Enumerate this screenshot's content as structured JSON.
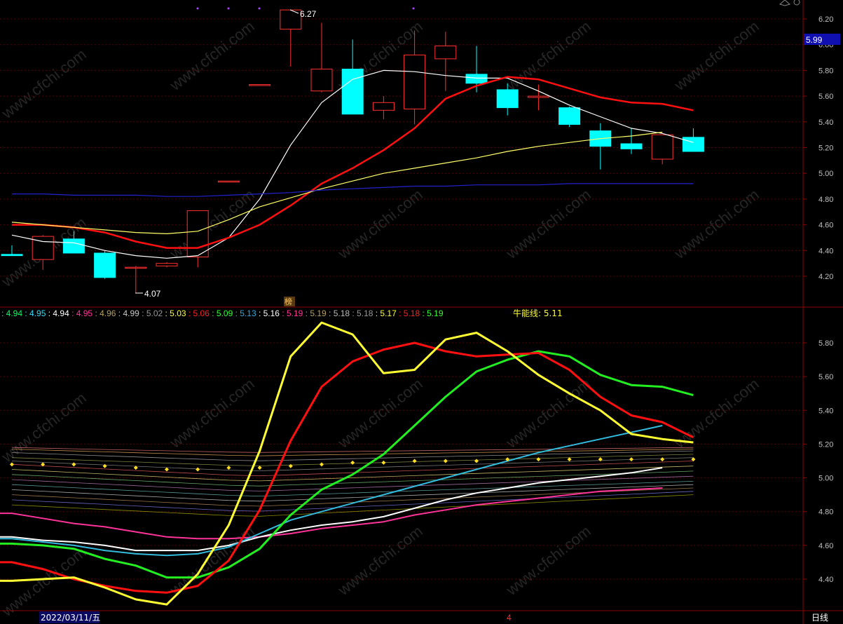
{
  "watermark": "www.cfchi.com",
  "colors": {
    "bg": "#000000",
    "grid": "#5a0000",
    "border": "#8b0000",
    "axis_text": "#c0c0c0",
    "bull": "#ff3030",
    "bear": "#00ffff",
    "ma5": "#ffffff",
    "ma10": "#ffff66",
    "ma20": "#ff1010",
    "ma60": "#2222cc"
  },
  "price_axis": {
    "ticks": [
      "6.20",
      "6.00",
      "5.80",
      "5.60",
      "5.40",
      "5.20",
      "5.00",
      "4.80",
      "4.60",
      "4.40",
      "4.20"
    ],
    "current_price": "5.99",
    "max_label": "6.27",
    "min_label": "4.07",
    "marker_label": "榜"
  },
  "indicator_axis": {
    "ticks": [
      "5.80",
      "5.60",
      "5.40",
      "5.20",
      "5.00",
      "4.80",
      "4.60",
      "4.40"
    ]
  },
  "legend": {
    "values": [
      {
        "text": ": 4.94",
        "color": "#00ff66"
      },
      {
        "text": ": 4.95",
        "color": "#33ddff"
      },
      {
        "text": ": 4.94",
        "color": "#ffffff"
      },
      {
        "text": ": 4.95",
        "color": "#ff3399"
      },
      {
        "text": ": 4.96",
        "color": "#b8a060"
      },
      {
        "text": ": 4.99",
        "color": "#c8c8c8"
      },
      {
        "text": ": 5.02",
        "color": "#999999"
      },
      {
        "text": ": 5.03",
        "color": "#ffff33"
      },
      {
        "text": ": 5.06",
        "color": "#ff2222"
      },
      {
        "text": ": 5.09",
        "color": "#33ff33"
      },
      {
        "text": ": 5.13",
        "color": "#33aadd"
      },
      {
        "text": ": 5.16",
        "color": "#ffffff"
      },
      {
        "text": ": 5.19",
        "color": "#ff3399"
      },
      {
        "text": ": 5.19",
        "color": "#b8a060"
      },
      {
        "text": ": 5.18",
        "color": "#bbbbbb"
      },
      {
        "text": ": 5.18",
        "color": "#999999"
      },
      {
        "text": ": 5.17",
        "color": "#ffff33"
      },
      {
        "text": ": 5.18",
        "color": "#ff2222"
      },
      {
        "text": ": 5.19",
        "color": "#33ff33"
      }
    ],
    "bull_line_label": "牛能线: 5.11"
  },
  "bottom_bar": {
    "date": "2022/03/11/五",
    "month_marker": "4",
    "period": "日线"
  },
  "chart_data": [
    {
      "type": "candlestick",
      "ylim": [
        4.1,
        6.3
      ],
      "candles": [
        {
          "o": 4.37,
          "h": 4.44,
          "l": 4.36,
          "c": 4.36
        },
        {
          "o": 4.33,
          "h": 4.52,
          "l": 4.25,
          "c": 4.51
        },
        {
          "o": 4.49,
          "h": 4.55,
          "l": 4.39,
          "c": 4.38
        },
        {
          "o": 4.38,
          "h": 4.4,
          "l": 4.18,
          "c": 4.19
        },
        {
          "o": 4.27,
          "h": 4.28,
          "l": 4.07,
          "c": 4.27
        },
        {
          "o": 4.28,
          "h": 4.31,
          "l": 4.27,
          "c": 4.3
        },
        {
          "o": 4.35,
          "h": 4.71,
          "l": 4.27,
          "c": 4.71
        },
        {
          "o": 4.94,
          "h": 4.94,
          "l": 4.94,
          "c": 4.94
        },
        {
          "o": 5.69,
          "h": 5.69,
          "l": 5.69,
          "c": 5.69
        },
        {
          "o": 6.12,
          "h": 6.27,
          "l": 5.83,
          "c": 6.27
        },
        {
          "o": 5.64,
          "h": 6.17,
          "l": 5.63,
          "c": 5.81
        },
        {
          "o": 5.81,
          "h": 6.04,
          "l": 5.46,
          "c": 5.46
        },
        {
          "o": 5.49,
          "h": 5.6,
          "l": 5.42,
          "c": 5.55
        },
        {
          "o": 5.5,
          "h": 6.11,
          "l": 5.38,
          "c": 5.92
        },
        {
          "o": 5.89,
          "h": 6.1,
          "l": 5.64,
          "c": 5.99
        },
        {
          "o": 5.77,
          "h": 5.99,
          "l": 5.63,
          "c": 5.7
        },
        {
          "o": 5.65,
          "h": 5.7,
          "l": 5.45,
          "c": 5.51
        },
        {
          "o": 5.59,
          "h": 5.69,
          "l": 5.49,
          "c": 5.6
        },
        {
          "o": 5.51,
          "h": 5.52,
          "l": 5.36,
          "c": 5.38
        },
        {
          "o": 5.33,
          "h": 5.39,
          "l": 5.03,
          "c": 5.21
        },
        {
          "o": 5.23,
          "h": 5.35,
          "l": 5.15,
          "c": 5.19
        },
        {
          "o": 5.11,
          "h": 5.3,
          "l": 5.07,
          "c": 5.3
        },
        {
          "o": 5.28,
          "h": 5.35,
          "l": 5.17,
          "c": 5.17
        }
      ],
      "ma_lines": [
        {
          "key": "ma5",
          "values": [
            4.52,
            4.47,
            4.46,
            4.4,
            4.36,
            4.34,
            4.36,
            4.5,
            4.8,
            5.22,
            5.55,
            5.73,
            5.8,
            5.79,
            5.76,
            5.74,
            5.74,
            5.64,
            5.53,
            5.44,
            5.35,
            5.31,
            5.24
          ]
        },
        {
          "key": "ma20",
          "values": [
            4.6,
            4.6,
            4.58,
            4.54,
            4.47,
            4.42,
            4.42,
            4.5,
            4.6,
            4.75,
            4.92,
            5.04,
            5.18,
            5.35,
            5.58,
            5.68,
            5.75,
            5.73,
            5.66,
            5.59,
            5.55,
            5.54,
            5.49
          ]
        },
        {
          "key": "ma10",
          "values": [
            4.62,
            4.6,
            4.58,
            4.56,
            4.54,
            4.53,
            4.55,
            4.64,
            4.74,
            4.81,
            4.88,
            4.94,
            5.0,
            5.04,
            5.08,
            5.12,
            5.17,
            5.21,
            5.24,
            5.27,
            5.29,
            5.32
          ]
        },
        {
          "key": "ma60",
          "values": [
            4.84,
            4.84,
            4.83,
            4.83,
            4.83,
            4.82,
            4.82,
            4.83,
            4.84,
            4.85,
            4.87,
            4.88,
            4.89,
            4.9,
            4.9,
            4.91,
            4.91,
            4.91,
            4.92,
            4.92,
            4.92,
            4.92,
            4.92
          ]
        }
      ]
    },
    {
      "type": "line",
      "ylim": [
        4.24,
        5.96
      ],
      "series": [
        {
          "color": "#ffff33",
          "width": 3,
          "values": [
            4.39,
            4.4,
            4.41,
            4.35,
            4.28,
            4.25,
            4.43,
            4.72,
            5.16,
            5.72,
            5.92,
            5.85,
            5.62,
            5.64,
            5.82,
            5.86,
            5.75,
            5.61,
            5.5,
            5.4,
            5.26,
            5.23,
            5.21
          ]
        },
        {
          "color": "#ff1010",
          "width": 3,
          "values": [
            4.5,
            4.46,
            4.4,
            4.36,
            4.33,
            4.32,
            4.36,
            4.51,
            4.81,
            5.22,
            5.54,
            5.69,
            5.76,
            5.8,
            5.75,
            5.72,
            5.73,
            5.74,
            5.64,
            5.48,
            5.37,
            5.33,
            5.24
          ]
        },
        {
          "color": "#22ee22",
          "width": 3,
          "values": [
            4.61,
            4.6,
            4.58,
            4.52,
            4.48,
            4.41,
            4.41,
            4.47,
            4.58,
            4.78,
            4.93,
            5.02,
            5.14,
            5.31,
            5.48,
            5.63,
            5.7,
            5.75,
            5.72,
            5.61,
            5.55,
            5.54,
            5.49
          ]
        },
        {
          "color": "#33bbdd",
          "width": 2,
          "values": [
            4.64,
            4.62,
            4.6,
            4.57,
            4.55,
            4.54,
            4.55,
            4.59,
            4.67,
            4.75,
            4.8,
            4.85,
            4.9,
            4.95,
            5.0,
            5.05,
            5.1,
            5.15,
            5.19,
            5.23,
            5.27,
            5.31
          ]
        },
        {
          "color": "#ffffff",
          "width": 2,
          "values": [
            4.65,
            4.63,
            4.62,
            4.6,
            4.57,
            4.57,
            4.57,
            4.6,
            4.65,
            4.69,
            4.72,
            4.74,
            4.77,
            4.82,
            4.87,
            4.91,
            4.94,
            4.97,
            4.99,
            5.01,
            5.03,
            5.06
          ]
        },
        {
          "color": "#ff3399",
          "width": 2,
          "values": [
            4.79,
            4.76,
            4.73,
            4.71,
            4.68,
            4.65,
            4.64,
            4.64,
            4.65,
            4.67,
            4.7,
            4.72,
            4.74,
            4.78,
            4.81,
            4.84,
            4.86,
            4.88,
            4.9,
            4.92,
            4.93,
            4.94
          ]
        }
      ],
      "dots": {
        "color": "#ffdd22",
        "values": [
          5.08,
          5.08,
          5.08,
          5.07,
          5.06,
          5.05,
          5.05,
          5.06,
          5.06,
          5.07,
          5.08,
          5.09,
          5.09,
          5.1,
          5.1,
          5.1,
          5.11,
          5.11,
          5.11,
          5.11,
          5.11,
          5.11,
          5.11
        ]
      },
      "bundle": {
        "colors": [
          "#ff8080",
          "#ffbb66",
          "#bbbbbb",
          "#aaaa55",
          "#999999",
          "#ff6666",
          "#ffee88",
          "#88dd88",
          "#cc88cc",
          "#77cccc",
          "#dddddd",
          "#cc9966",
          "#8888ff",
          "#bbbb00"
        ],
        "start": [
          5.18,
          5.17,
          5.15,
          5.12,
          5.1,
          5.08,
          5.05,
          5.02,
          4.99,
          4.96,
          4.93,
          4.9,
          4.87,
          4.84
        ],
        "mid": [
          5.15,
          5.13,
          5.1,
          5.07,
          5.04,
          5.01,
          4.98,
          4.95,
          4.92,
          4.89,
          4.86,
          4.83,
          4.8,
          4.77
        ],
        "end": [
          5.18,
          5.17,
          5.16,
          5.14,
          5.12,
          5.1,
          5.07,
          5.04,
          5.01,
          4.98,
          4.96,
          4.94,
          4.92,
          4.9
        ]
      }
    }
  ]
}
